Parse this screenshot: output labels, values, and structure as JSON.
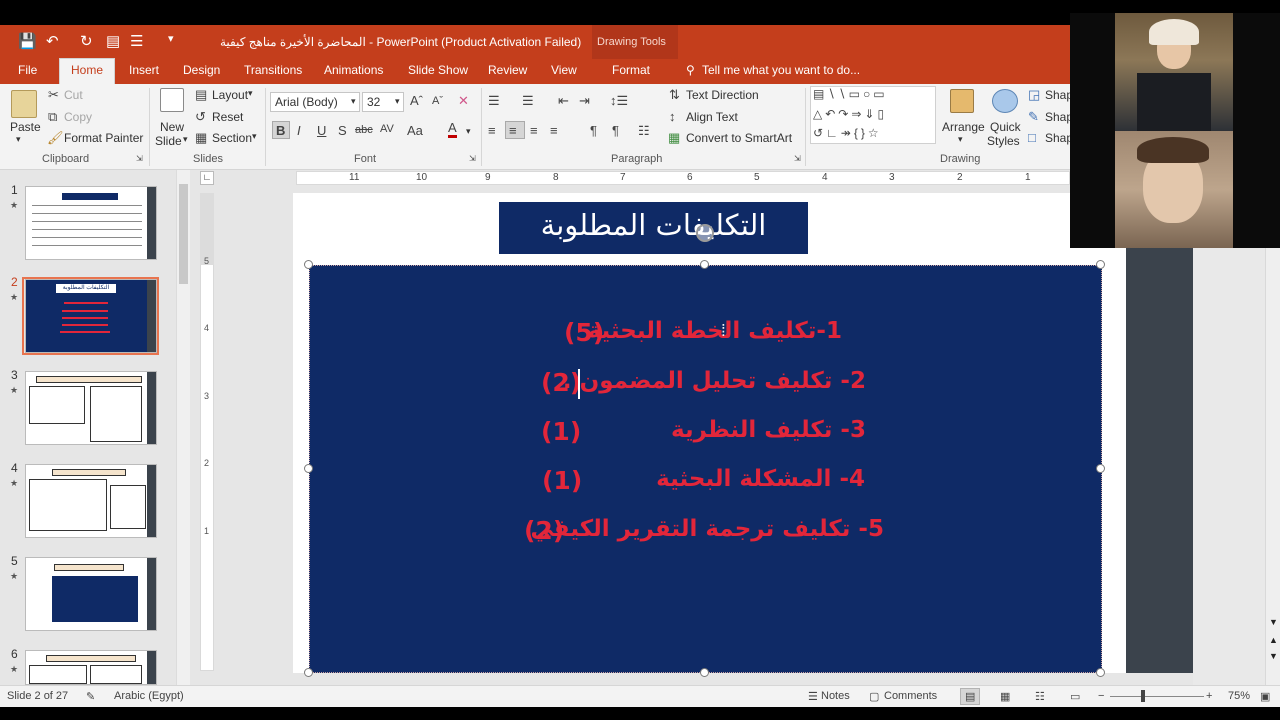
{
  "window": {
    "title": "المحاضرة الأخيرة مناهج كيفية - PowerPoint (Product Activation Failed)",
    "contextual_group": "Drawing Tools"
  },
  "tabs": [
    "File",
    "Home",
    "Insert",
    "Design",
    "Transitions",
    "Animations",
    "Slide Show",
    "Review",
    "View",
    "Format"
  ],
  "tell_me": "Tell me what you want to do...",
  "ribbon": {
    "clipboard": {
      "paste": "Paste",
      "cut": "Cut",
      "copy": "Copy",
      "format_painter": "Format Painter",
      "group": "Clipboard"
    },
    "slides": {
      "new_slide_1": "New",
      "new_slide_2": "Slide",
      "layout": "Layout",
      "reset": "Reset",
      "section": "Section",
      "group": "Slides"
    },
    "font": {
      "name": "Arial (Body)",
      "size": "32",
      "group": "Font"
    },
    "paragraph": {
      "text_direction": "Text Direction",
      "align_text": "Align Text",
      "convert_smartart": "Convert to SmartArt",
      "group": "Paragraph"
    },
    "drawing": {
      "arrange": "Arrange",
      "quick_styles_1": "Quick",
      "quick_styles_2": "Styles",
      "shape_1": "Shap",
      "shape_2": "Shap",
      "shape_3": "Shap",
      "group": "Drawing"
    }
  },
  "slides_panel": {
    "thumbs": [
      {
        "num": "1",
        "star": "★"
      },
      {
        "num": "2",
        "star": "★"
      },
      {
        "num": "3",
        "star": "★"
      },
      {
        "num": "4",
        "star": "★"
      },
      {
        "num": "5",
        "star": "★"
      },
      {
        "num": "6",
        "star": "★"
      }
    ],
    "thumb2_title": "التكليفات المطلوبة"
  },
  "ruler": {
    "h": [
      "11",
      "10",
      "9",
      "8",
      "7",
      "6",
      "5",
      "4",
      "3",
      "2",
      "1"
    ],
    "v": [
      "5",
      "4",
      "3",
      "2",
      "1"
    ]
  },
  "slide": {
    "title": "التكليفات المطلوبة",
    "items": [
      {
        "text": "1-تكليف الخطة البحثية",
        "count": "(5)"
      },
      {
        "text": "2-  تكليف تحليل المضمون .",
        "count": "(2)"
      },
      {
        "text": "3- تكليف النظرية",
        "count": "(1)"
      },
      {
        "text": "4- المشكلة البحثية",
        "count": "(1)"
      },
      {
        "text": "5- تكليف ترجمة  التقرير الكيفي",
        "count": "(2)"
      }
    ]
  },
  "status": {
    "slide_of": "Slide 2 of 27",
    "language": "Arabic (Egypt)",
    "notes": "Notes",
    "comments": "Comments",
    "zoom": "75%"
  },
  "colors": {
    "accent": "#c43e1c",
    "slide_bg": "#0f2a66",
    "bullet_text": "#e2263a"
  }
}
